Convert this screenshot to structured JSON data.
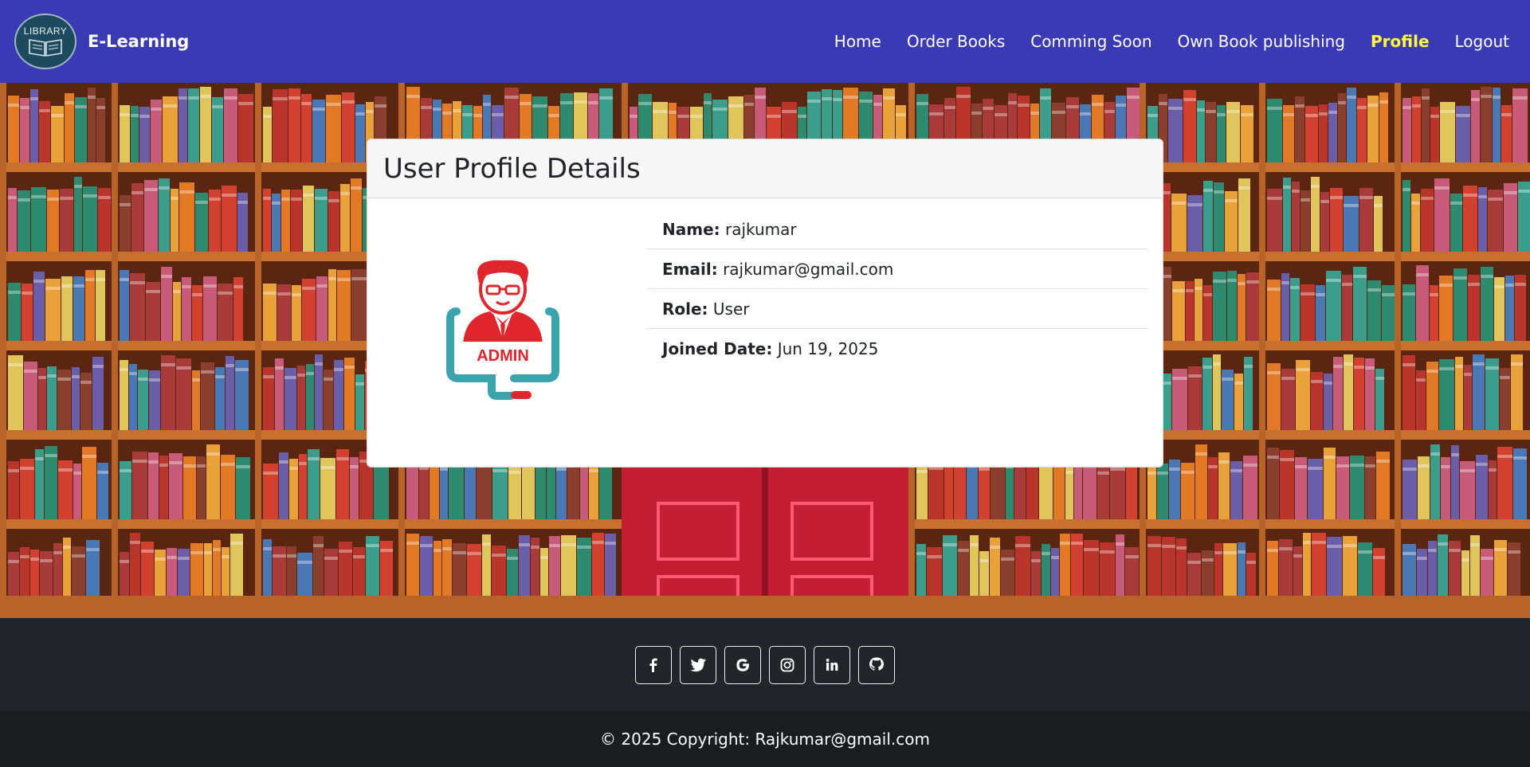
{
  "navbar": {
    "logo_text": "LIBRARY",
    "brand": "E-Learning",
    "links": [
      {
        "label": "Home"
      },
      {
        "label": "Order Books"
      },
      {
        "label": "Comming Soon"
      },
      {
        "label": "Own Book publishing"
      },
      {
        "label": "Profile",
        "active": true
      },
      {
        "label": "Logout"
      }
    ]
  },
  "profile": {
    "title": "User Profile Details",
    "avatar_text": "ADMIN",
    "fields": [
      {
        "label": "Name:",
        "value": "rajkumar"
      },
      {
        "label": "Email:",
        "value": "rajkumar@gmail.com"
      },
      {
        "label": "Role:",
        "value": "User"
      },
      {
        "label": "Joined Date:",
        "value": "Jun 19, 2025"
      }
    ]
  },
  "footer": {
    "social": [
      "facebook-icon",
      "twitter-icon",
      "google-icon",
      "instagram-icon",
      "linkedin-icon",
      "github-icon"
    ],
    "copyright": "© 2025 Copyright: Rajkumar@gmail.com"
  },
  "colors": {
    "navbar_bg": "#3a3ab4",
    "active_link": "#ffff3d",
    "footer_bg": "#212529",
    "avatar_red": "#e0262c",
    "avatar_teal": "#3aa3ab"
  }
}
